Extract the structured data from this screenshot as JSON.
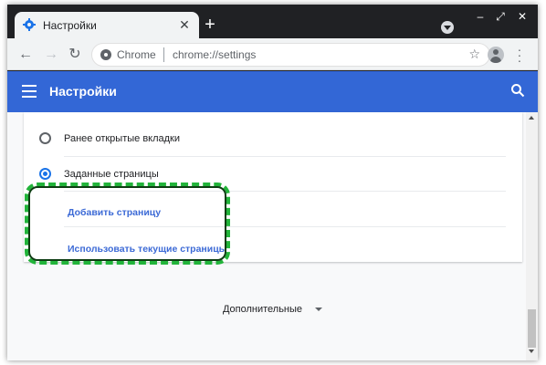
{
  "browser": {
    "tab_title": "Настройки",
    "tab_close": "✕",
    "new_tab": "+",
    "omnibox_chip": "Chrome",
    "url": "chrome://settings",
    "window_controls": {
      "minimize": "–",
      "maximize": "⤢",
      "close": "✕"
    }
  },
  "header": {
    "title": "Настройки"
  },
  "settings": {
    "options": [
      {
        "label": "Ранее открытые вкладки",
        "checked": false
      },
      {
        "label": "Заданные страницы",
        "checked": true
      }
    ],
    "links": [
      {
        "label": "Добавить страницу"
      },
      {
        "label": "Использовать текущие страницы"
      }
    ],
    "advanced_label": "Дополнительные"
  },
  "colors": {
    "header": "#3367d6",
    "link": "#3c6ad6",
    "highlight": "#22b43a",
    "radio_checked": "#1a73e8"
  },
  "icons": [
    "settings-gear-icon",
    "back-icon",
    "forward-icon",
    "reload-icon",
    "site-info-icon",
    "star-icon",
    "avatar-icon",
    "menu-icon",
    "search-icon",
    "hamburger-icon"
  ]
}
